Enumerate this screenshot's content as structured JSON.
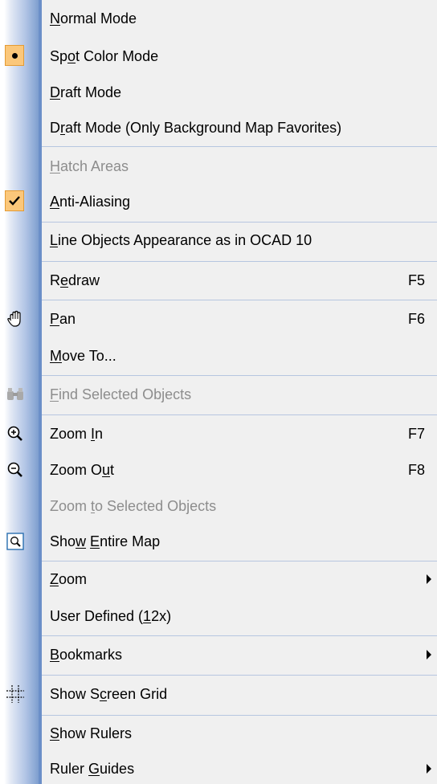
{
  "menu": {
    "items": [
      {
        "label": "Normal Mode",
        "u": "N",
        "pre": "",
        "post": "ormal Mode"
      },
      {
        "label": "Spot Color Mode",
        "pre": "Sp",
        "u": "o",
        "post": "t Color Mode",
        "state": "radio-selected"
      },
      {
        "label": "Draft Mode",
        "pre": "",
        "u": "D",
        "post": "raft Mode"
      },
      {
        "label": "Draft Mode (Only Background Map Favorites)",
        "pre": "D",
        "u": "r",
        "post": "aft Mode (Only Background Map Favorites)"
      },
      {
        "label": "Hatch Areas",
        "pre": "",
        "u": "H",
        "post": "atch Areas",
        "disabled": true
      },
      {
        "label": "Anti-Aliasing",
        "pre": "",
        "u": "A",
        "post": "nti-Aliasing",
        "state": "checked"
      },
      {
        "label": "Line Objects Appearance as in OCAD 10",
        "pre": "",
        "u": "L",
        "post": "ine Objects Appearance as in OCAD 10"
      },
      {
        "label": "Redraw",
        "pre": "R",
        "u": "e",
        "post": "draw",
        "shortcut": "F5"
      },
      {
        "label": "Pan",
        "pre": "",
        "u": "P",
        "post": "an",
        "shortcut": "F6",
        "icon": "hand-icon"
      },
      {
        "label": "Move To...",
        "pre": "",
        "u": "M",
        "post": "ove To..."
      },
      {
        "label": "Find Selected Objects",
        "pre": "",
        "u": "F",
        "post": "ind Selected Objects",
        "disabled": true,
        "icon": "binoculars-icon"
      },
      {
        "label": "Zoom In",
        "pre": "Zoom ",
        "u": "I",
        "post": "n",
        "shortcut": "F7",
        "icon": "zoom-in-icon"
      },
      {
        "label": "Zoom Out",
        "pre": "Zoom O",
        "u": "u",
        "post": "t",
        "shortcut": "F8",
        "icon": "zoom-out-icon"
      },
      {
        "label": "Zoom to Selected Objects",
        "pre": "Zoom ",
        "u": "t",
        "post": "o Selected Objects",
        "disabled": true
      },
      {
        "label": "Show Entire Map",
        "pre": "Sho",
        "u": "w",
        "post": " ",
        "u2": "E",
        "post2": "ntire Map",
        "icon": "show-entire-map-icon"
      },
      {
        "label": "Zoom",
        "pre": "",
        "u": "Z",
        "post": "oom",
        "submenu": true
      },
      {
        "label": "User Defined (12x)",
        "pre": "User Defined (",
        "u": "1",
        "post": "2x)"
      },
      {
        "label": "Bookmarks",
        "pre": "",
        "u": "B",
        "post": "ookmarks",
        "submenu": true
      },
      {
        "label": "Show Screen Grid",
        "pre": "Show S",
        "u": "c",
        "post": "reen Grid",
        "icon": "screen-grid-icon"
      },
      {
        "label": "Show Rulers",
        "pre": "",
        "u": "S",
        "post": "how Rulers"
      },
      {
        "label": "Ruler Guides",
        "pre": "Ruler ",
        "u": "G",
        "post": "uides",
        "submenu": true
      }
    ],
    "colors": {
      "gutter_dark": "#7597cc",
      "separator": "#b6c6e0",
      "checked_bg": "#fbc77a",
      "disabled_text": "#8d8d8d"
    }
  }
}
